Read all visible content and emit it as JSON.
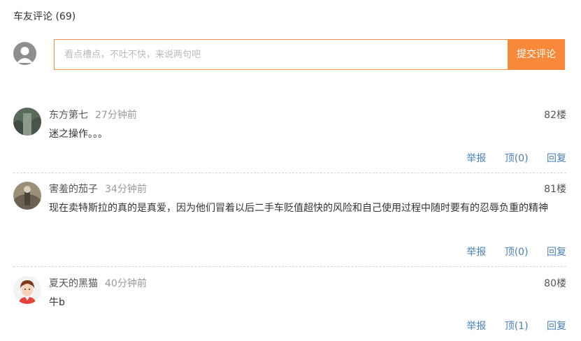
{
  "header": {
    "title": "车友评论 (69)"
  },
  "compose": {
    "placeholder": "看点槽点，不吐不快，来说两句吧",
    "submit_label": "提交评论"
  },
  "comments": [
    {
      "username": "东方第七",
      "time": "27分钟前",
      "floor": "82楼",
      "content": "迷之操作。。。",
      "report_label": "举报",
      "vote_label": "顶",
      "vote_count": "(0)",
      "reply_label": "回复"
    },
    {
      "username": "害羞的茄子",
      "time": "34分钟前",
      "floor": "81楼",
      "content": "现在卖特斯拉的真的是真爱，因为他们冒着以后二手车贬值超快的风险和自己使用过程中随时要有的忍辱负重的精神",
      "report_label": "举报",
      "vote_label": "顶",
      "vote_count": "(0)",
      "reply_label": "回复"
    },
    {
      "username": "夏天的黑猫",
      "time": "40分钟前",
      "floor": "80楼",
      "content": "牛b",
      "report_label": "举报",
      "vote_label": "顶",
      "vote_count": "(1)",
      "reply_label": "回复"
    }
  ],
  "colors": {
    "accent": "#f8893a",
    "link": "#4a7fb8"
  }
}
